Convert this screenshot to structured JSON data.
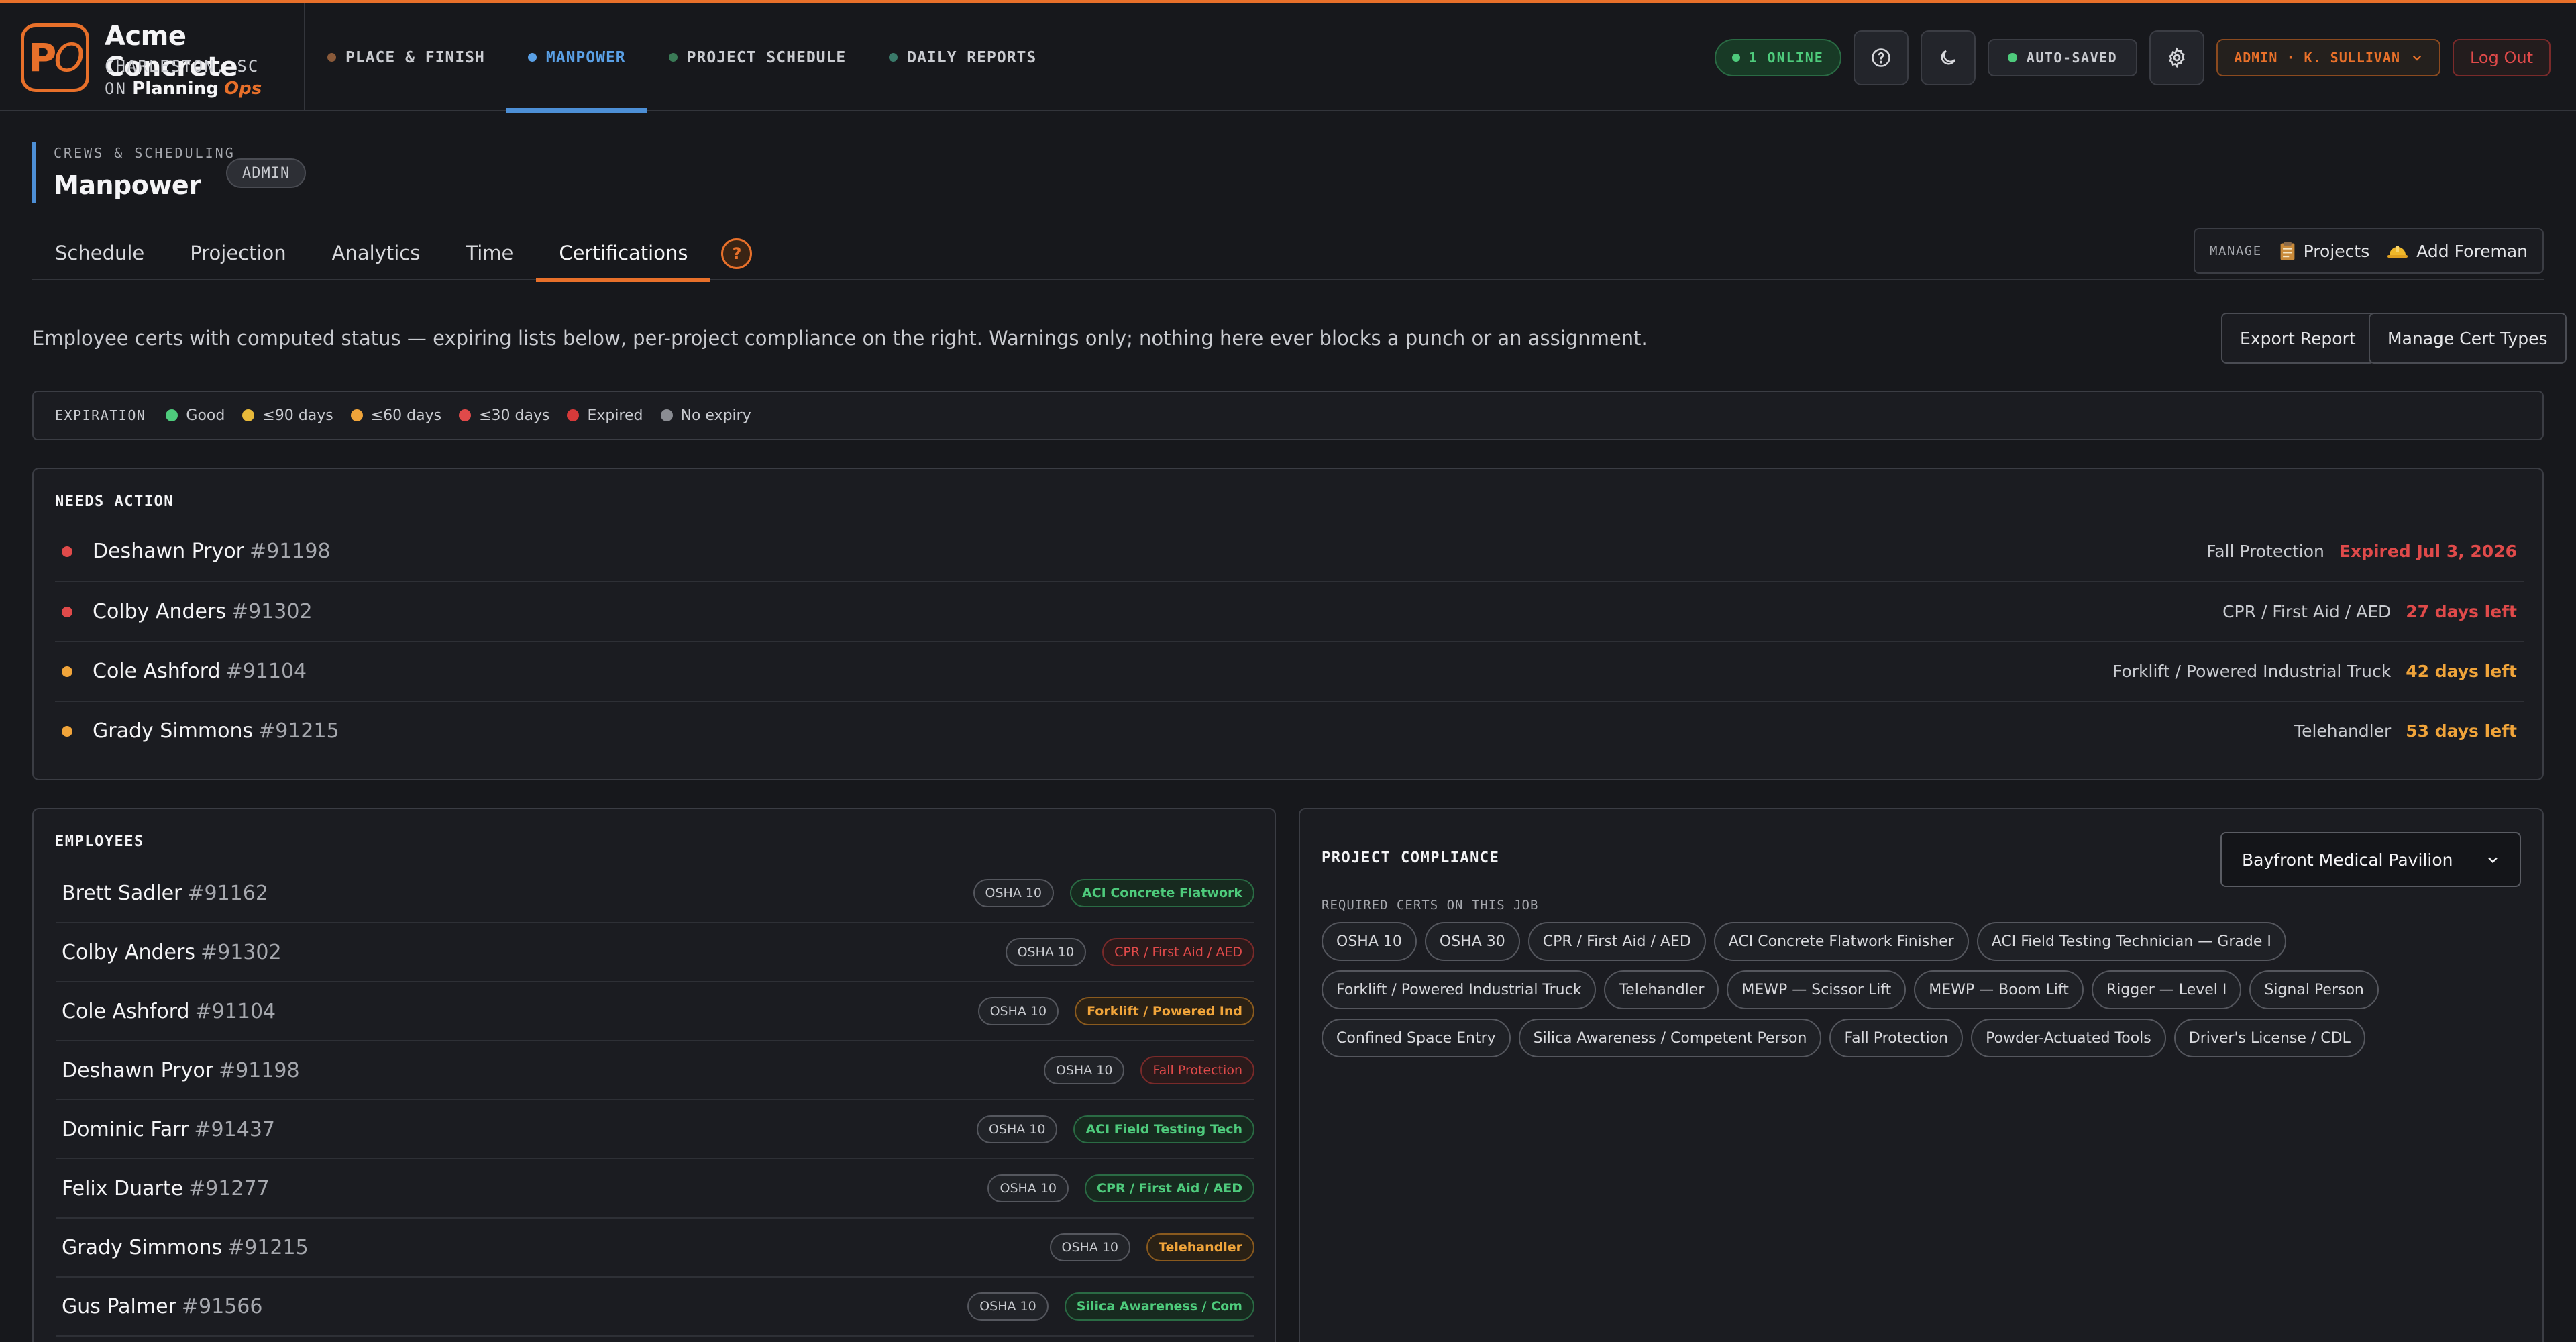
{
  "brand": {
    "logo_text": "PO",
    "name": "Acme Concrete",
    "location": "CHARLESTON, SC",
    "on_label": "ON",
    "product_a": "Planning",
    "product_b": "Ops"
  },
  "nav": {
    "items": [
      {
        "label": "PLACE & FINISH",
        "color": "#8a5a3a"
      },
      {
        "label": "MANPOWER",
        "color": "#5aa0e6"
      },
      {
        "label": "PROJECT SCHEDULE",
        "color": "#3a7a56"
      },
      {
        "label": "DAILY REPORTS",
        "color": "#3a7a6a"
      }
    ],
    "active": "MANPOWER"
  },
  "header": {
    "online": "1 ONLINE",
    "autosave": "AUTO-SAVED",
    "admin": "ADMIN · K. SULLIVAN",
    "logout": "Log Out",
    "icons": [
      "help-icon",
      "moon-icon",
      "gear-icon",
      "chevron-down-icon"
    ]
  },
  "page": {
    "eyebrow": "CREWS & SCHEDULING",
    "title": "Manpower",
    "badge": "ADMIN"
  },
  "tabs": {
    "items": [
      "Schedule",
      "Projection",
      "Analytics",
      "Time",
      "Certifications"
    ],
    "active": "Certifications",
    "help": "?"
  },
  "manage": {
    "label": "MANAGE",
    "projects": "Projects",
    "add_foreman": "Add Foreman"
  },
  "intro": {
    "text": "Employee certs with computed status — expiring lists below, per-project compliance on the right. Warnings only; nothing here ever blocks a punch or an assignment.",
    "export": "Export Report",
    "manage_types": "Manage Cert Types"
  },
  "legend": {
    "title": "EXPIRATION",
    "items": [
      {
        "label": "Good",
        "color": "#4ecb7c"
      },
      {
        "label": "≤90 days",
        "color": "#e8b93a"
      },
      {
        "label": "≤60 days",
        "color": "#f0a43a"
      },
      {
        "label": "≤30 days",
        "color": "#e04a4a"
      },
      {
        "label": "Expired",
        "color": "#d63a3a"
      },
      {
        "label": "No expiry",
        "color": "#8a8c92"
      }
    ]
  },
  "needs_action": {
    "title": "NEEDS ACTION",
    "rows": [
      {
        "name": "Deshawn Pryor",
        "id": "#91198",
        "cert": "Fall Protection",
        "status": "Expired Jul 3, 2026",
        "color": "#e04a4a"
      },
      {
        "name": "Colby Anders",
        "id": "#91302",
        "cert": "CPR / First Aid / AED",
        "status": "27 days left",
        "color": "#e04a4a"
      },
      {
        "name": "Cole Ashford",
        "id": "#91104",
        "cert": "Forklift / Powered Industrial Truck",
        "status": "42 days left",
        "color": "#f0a43a"
      },
      {
        "name": "Grady Simmons",
        "id": "#91215",
        "cert": "Telehandler",
        "status": "53 days left",
        "color": "#f0a43a"
      }
    ]
  },
  "employees": {
    "title": "EMPLOYEES",
    "rows": [
      {
        "name": "Brett Sadler",
        "id": "#91162",
        "base": "OSHA 10",
        "cert": "ACI Concrete Flatwork",
        "level": "good"
      },
      {
        "name": "Colby Anders",
        "id": "#91302",
        "base": "OSHA 10",
        "cert": "CPR / First Aid / AED",
        "level": "bad"
      },
      {
        "name": "Cole Ashford",
        "id": "#91104",
        "base": "OSHA 10",
        "cert": "Forklift / Powered Ind",
        "level": "warn"
      },
      {
        "name": "Deshawn Pryor",
        "id": "#91198",
        "base": "OSHA 10",
        "cert": "Fall Protection",
        "level": "bad"
      },
      {
        "name": "Dominic Farr",
        "id": "#91437",
        "base": "OSHA 10",
        "cert": "ACI Field Testing Tech",
        "level": "good"
      },
      {
        "name": "Felix Duarte",
        "id": "#91277",
        "base": "OSHA 10",
        "cert": "CPR / First Aid / AED",
        "level": "good"
      },
      {
        "name": "Grady Simmons",
        "id": "#91215",
        "base": "OSHA 10",
        "cert": "Telehandler",
        "level": "warn"
      },
      {
        "name": "Gus Palmer",
        "id": "#91566",
        "base": "OSHA 10",
        "cert": "Silica Awareness / Com",
        "level": "good"
      }
    ]
  },
  "compliance": {
    "title": "PROJECT COMPLIANCE",
    "project": "Bayfront Medical Pavilion",
    "required_label": "REQUIRED CERTS ON THIS JOB",
    "required": [
      "OSHA 10",
      "OSHA 30",
      "CPR / First Aid / AED",
      "ACI Concrete Flatwork Finisher",
      "ACI Field Testing Technician — Grade I",
      "Forklift / Powered Industrial Truck",
      "Telehandler",
      "MEWP — Scissor Lift",
      "MEWP — Boom Lift",
      "Rigger — Level I",
      "Signal Person",
      "Confined Space Entry",
      "Silica Awareness / Competent Person",
      "Fall Protection",
      "Powder-Actuated Tools",
      "Driver's License / CDL"
    ]
  }
}
